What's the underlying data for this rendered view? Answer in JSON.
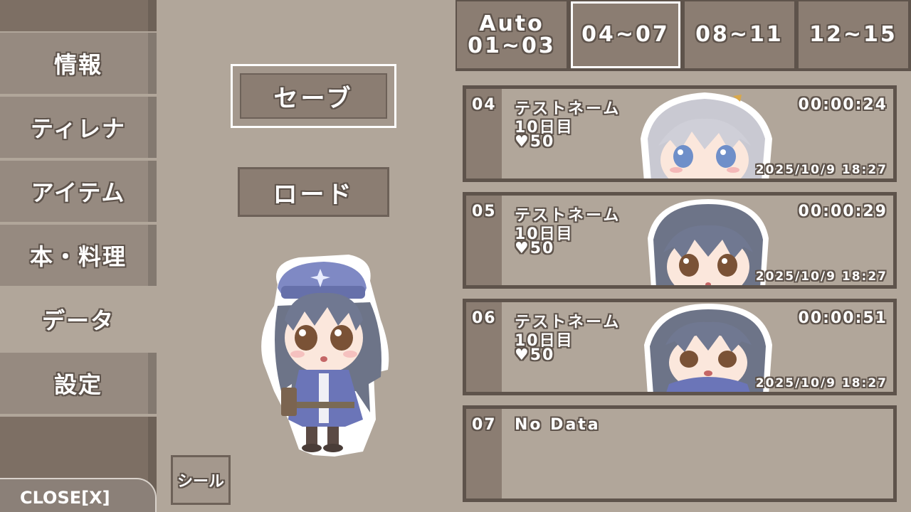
{
  "sidebar": {
    "items": [
      {
        "label": "情報"
      },
      {
        "label": "ティレナ"
      },
      {
        "label": "アイテム"
      },
      {
        "label": "本・料理"
      },
      {
        "label": "データ"
      },
      {
        "label": "設定"
      }
    ],
    "close_label": "CLOSE[X]"
  },
  "actions": {
    "save_label": "セーブ",
    "load_label": "ロード",
    "seal_label": "シール"
  },
  "tabs": [
    {
      "line1": "Auto",
      "line2": "01~03"
    },
    {
      "line1": "04~07",
      "line2": ""
    },
    {
      "line1": "08~11",
      "line2": ""
    },
    {
      "line1": "12~15",
      "line2": ""
    }
  ],
  "slots": [
    {
      "num": "04",
      "name": "テストネーム",
      "day": "10日目",
      "heart": "♥50",
      "time": "00:00:24",
      "date": "2025/10/9 18:27"
    },
    {
      "num": "05",
      "name": "テストネーム",
      "day": "10日目",
      "heart": "♥50",
      "time": "00:00:29",
      "date": "2025/10/9 18:27"
    },
    {
      "num": "06",
      "name": "テストネーム",
      "day": "10日目",
      "heart": "♥50",
      "time": "00:00:51",
      "date": "2025/10/9 18:27"
    },
    {
      "num": "07",
      "nodata": "No Data"
    }
  ],
  "colors": {
    "background": "#b1a69a",
    "panel": "#8b7d72",
    "border": "#5e534b",
    "active": "#ffffff"
  }
}
